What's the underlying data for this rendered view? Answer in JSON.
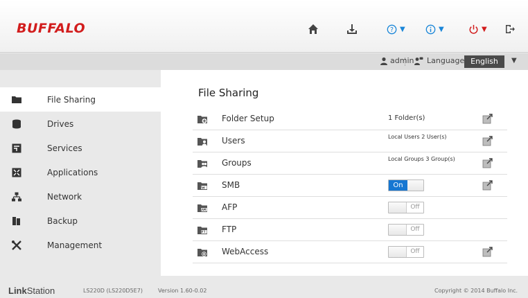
{
  "app": {
    "logo": "BUFFALO"
  },
  "header": {
    "colors": {
      "help": "#1a86d8",
      "info": "#1a86d8",
      "power": "#d21d1d",
      "icon": "#444444"
    }
  },
  "userbar": {
    "user": "admin",
    "language_label": "Language",
    "language_value": "English"
  },
  "sidebar": {
    "items": [
      {
        "label": "File Sharing",
        "icon": "folder-icon"
      },
      {
        "label": "Drives",
        "icon": "drive-icon"
      },
      {
        "label": "Services",
        "icon": "services-icon"
      },
      {
        "label": "Applications",
        "icon": "applications-icon"
      },
      {
        "label": "Network",
        "icon": "network-icon"
      },
      {
        "label": "Backup",
        "icon": "backup-icon"
      },
      {
        "label": "Management",
        "icon": "management-icon"
      }
    ]
  },
  "main": {
    "title": "File Sharing",
    "rows": [
      {
        "label": "Folder Setup",
        "value": "1 Folder(s)"
      },
      {
        "label": "Users",
        "value": "Local Users 2 User(s)"
      },
      {
        "label": "Groups",
        "value": "Local Groups 3 Group(s)"
      },
      {
        "label": "SMB",
        "toggle": "On"
      },
      {
        "label": "AFP",
        "toggle": "Off"
      },
      {
        "label": "FTP",
        "toggle": "Off"
      },
      {
        "label": "WebAccess",
        "toggle": "Off"
      }
    ],
    "accent": "#1677d2"
  },
  "footer": {
    "brand_bold": "Link",
    "brand_rest": "Station",
    "model": "LS220D (LS220D5E7)",
    "version": "Version 1.60-0.02",
    "copyright": "Copyright © 2014 Buffalo Inc."
  }
}
